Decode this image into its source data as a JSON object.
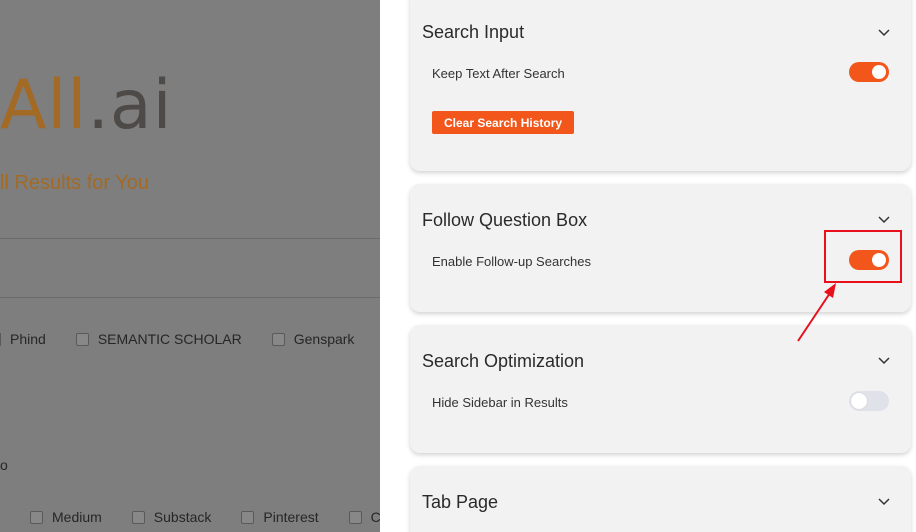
{
  "background": {
    "logo_brand": "All",
    "logo_suffix": ".ai",
    "tagline": "ll Results for You",
    "engines": [
      "Phind",
      "SEMANTIC SCHOLAR",
      "Genspark"
    ],
    "stray_text": "o",
    "sites": [
      "Medium",
      "Substack",
      "Pinterest"
    ],
    "site_cut": "C"
  },
  "panel": {
    "search_input": {
      "title": "Search Input",
      "setting_label": "Keep Text After Search",
      "setting_on": true,
      "button_label": "Clear Search History"
    },
    "follow_question": {
      "title": "Follow Question Box",
      "setting_label": "Enable Follow-up Searches",
      "setting_on": true
    },
    "search_optimization": {
      "title": "Search Optimization",
      "setting_label": "Hide Sidebar in Results",
      "setting_on": false
    },
    "tab_page": {
      "title": "Tab Page"
    }
  },
  "colors": {
    "accent": "#f2561a",
    "annotation": "#e8101b",
    "toggle_off": "#dfe2e8",
    "card_bg": "#f2f2f2"
  },
  "icons": [
    "chevron-down-icon",
    "arrow-annotation-icon"
  ]
}
